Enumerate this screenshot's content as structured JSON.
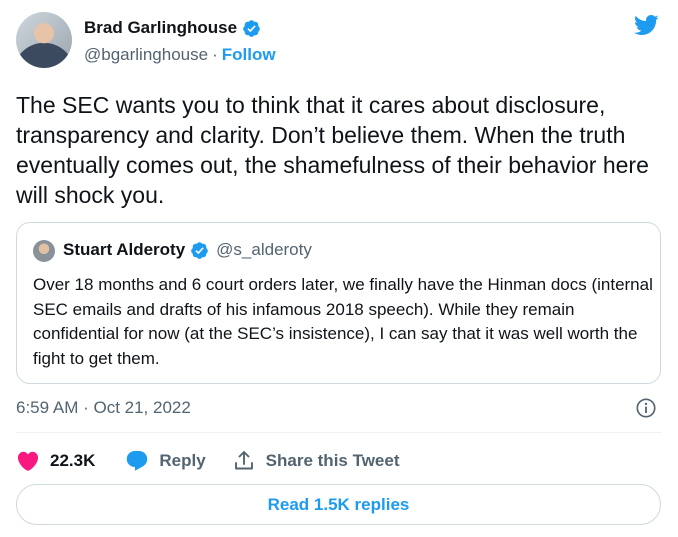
{
  "author": {
    "name": "Brad Garlinghouse",
    "handle": "@bgarlinghouse",
    "separator": "·",
    "follow_label": "Follow"
  },
  "tweet": {
    "text": "The SEC wants you to think that it cares about disclosure, transparency and clarity. Don’t believe them. When the truth eventually comes out, the shamefulness of their behavior here will shock you.",
    "timestamp": "6:59 AM · Oct 21, 2022"
  },
  "quoted_tweet": {
    "name": "Stuart Alderoty",
    "handle": "@s_alderoty",
    "text": "Over 18 months and 6 court orders later, we finally have the Hinman docs (internal SEC emails and drafts of his infamous 2018 speech). While they remain confidential for now (at the SEC’s insistence), I can say that it was well worth the fight to get them."
  },
  "actions": {
    "like_count": "22.3K",
    "reply_label": "Reply",
    "share_label": "Share this Tweet"
  },
  "read_replies_label": "Read 1.5K replies",
  "colors": {
    "accent": "#1d9bf0",
    "like": "#f91880",
    "text": "#0f1419",
    "muted": "#536471",
    "border": "#cfd9de"
  },
  "icons": [
    "verified-badge-icon",
    "twitter-bird-icon",
    "info-icon",
    "heart-icon",
    "reply-bubble-icon",
    "share-icon"
  ]
}
